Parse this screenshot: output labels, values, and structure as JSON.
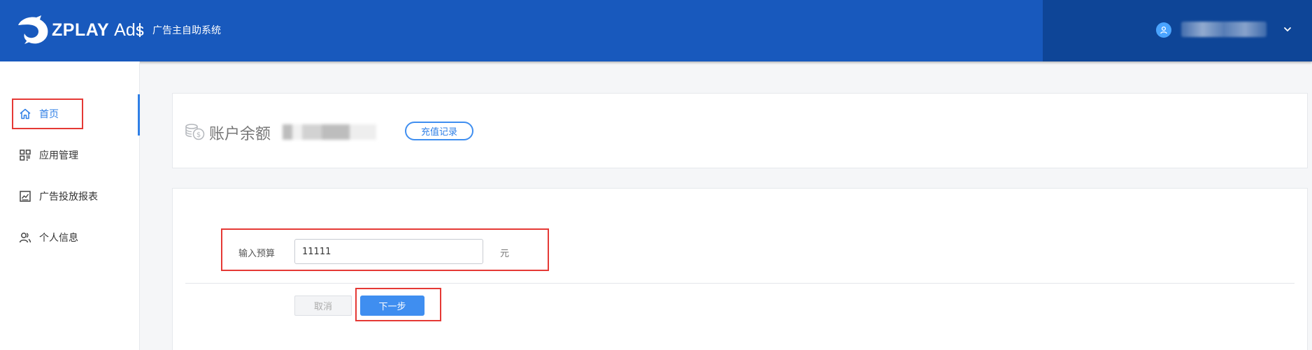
{
  "header": {
    "brand": "ZPLAY",
    "brand_suffix": "Ads",
    "system_title": "广告主自助系统",
    "user_icon": "user-icon",
    "chevron_icon": "chevron-down-icon",
    "colors": {
      "primary": "#1859bd",
      "dark": "#0e4597"
    }
  },
  "sidebar": {
    "items": [
      {
        "label": "首页",
        "icon": "home-icon",
        "active": true
      },
      {
        "label": "应用管理",
        "icon": "apps-grid-icon",
        "active": false
      },
      {
        "label": "广告投放报表",
        "icon": "chart-report-icon",
        "active": false
      },
      {
        "label": "个人信息",
        "icon": "users-icon",
        "active": false
      }
    ],
    "active_color": "#2f7fe6"
  },
  "balance": {
    "icon": "coins-icon",
    "label": "账户余额",
    "recharge_button": "充值记录"
  },
  "form": {
    "budget_label": "输入预算",
    "budget_value": "11111",
    "unit": "元",
    "cancel_button": "取消",
    "next_button": "下一步"
  },
  "annotation_color": "#e53935"
}
